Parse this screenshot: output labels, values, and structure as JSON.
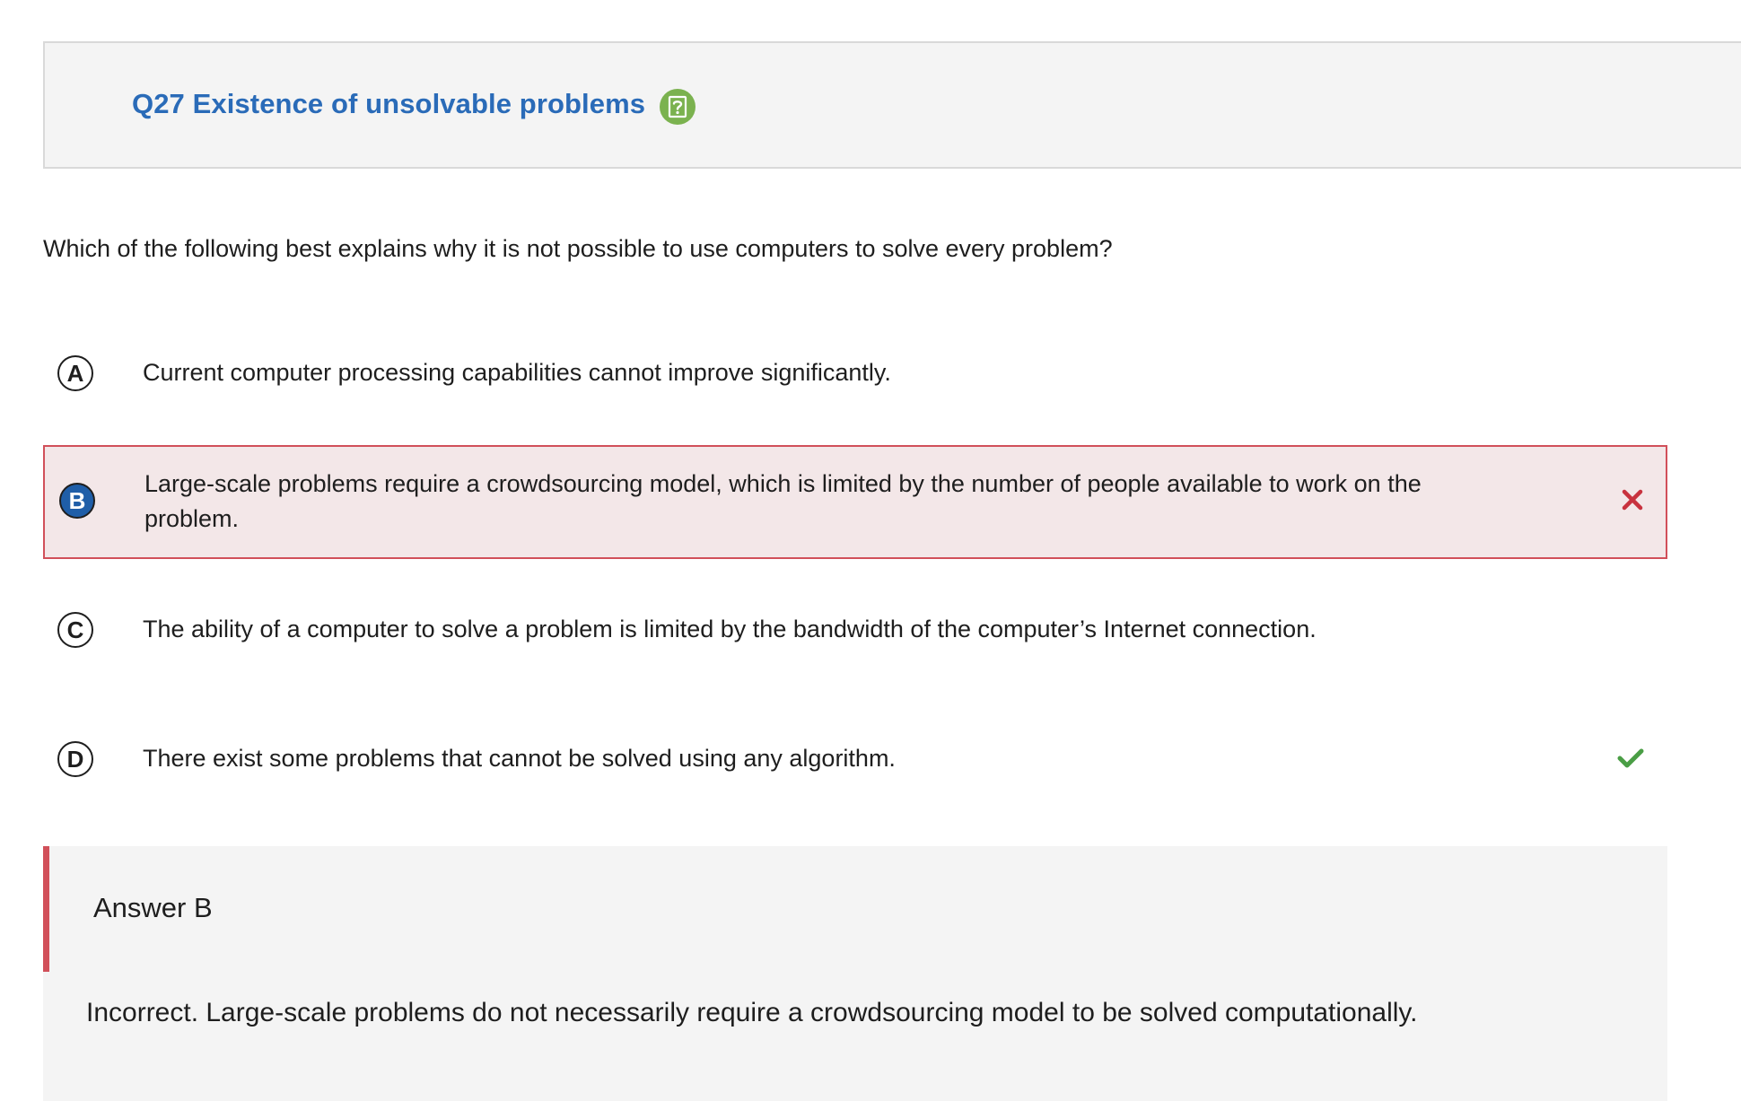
{
  "question": {
    "title": "Q27 Existence of unsolvable problems",
    "help_icon": "question-mark-icon",
    "stem": "Which of the following best explains why it is not possible to use computers to solve every problem?"
  },
  "options": [
    {
      "letter": "A",
      "text": "Current computer processing capabilities cannot improve significantly.",
      "selected": false,
      "status": ""
    },
    {
      "letter": "B",
      "text": "Large-scale problems require a crowdsourcing model, which is limited by the number of people available to work on the problem.",
      "selected": true,
      "status": "incorrect"
    },
    {
      "letter": "C",
      "text": "The ability of a computer to solve a problem is limited by the bandwidth of the computer’s Internet connection.",
      "selected": false,
      "status": ""
    },
    {
      "letter": "D",
      "text": "There exist some problems that cannot be solved using any algorithm.",
      "selected": false,
      "status": "correct"
    }
  ],
  "answer": {
    "title": "Answer B",
    "explanation": "Incorrect. Large-scale problems do not necessarily require a crowdsourcing model to be solved computationally."
  },
  "colors": {
    "title_blue": "#2a6bb8",
    "help_green": "#7bb24f",
    "selected_fill": "#1f5ea8",
    "wrong_red": "#c8323e",
    "wrong_border": "#d1505a",
    "wrong_bg": "#f3e7e8",
    "correct_green": "#4a9e45",
    "panel_gray": "#f4f4f4"
  }
}
